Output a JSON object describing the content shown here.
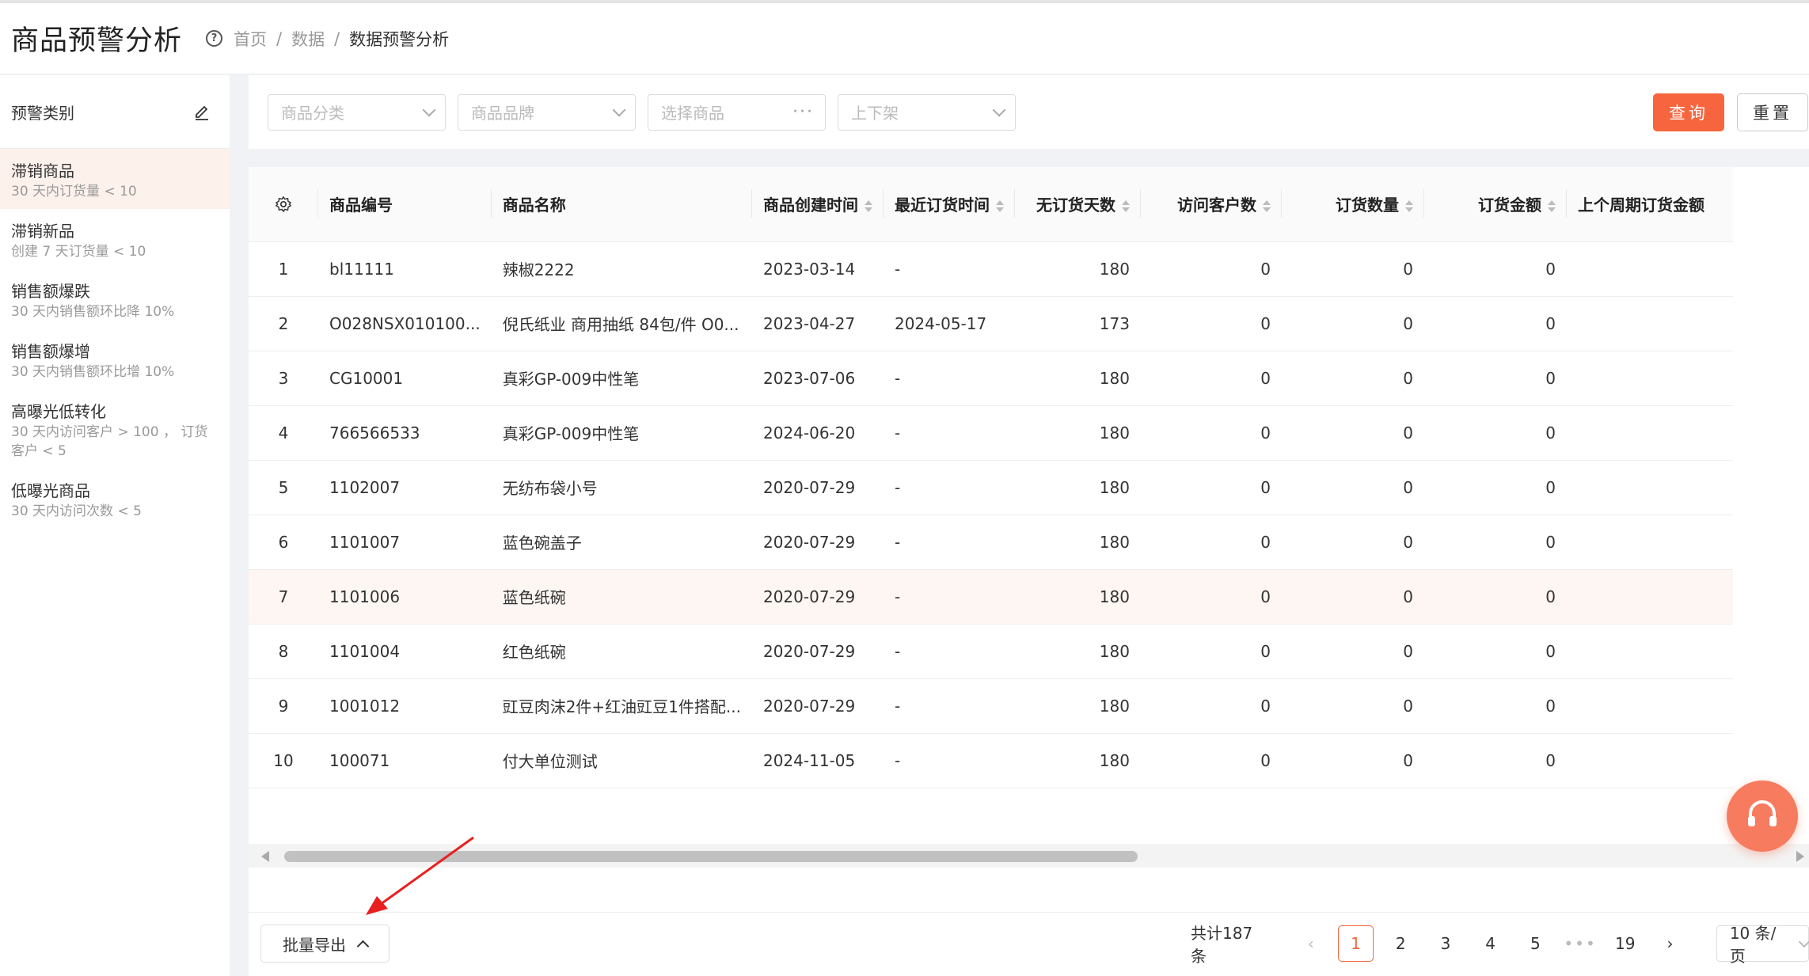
{
  "header": {
    "title": "商品预警分析",
    "breadcrumb": [
      "首页",
      "数据",
      "数据预警分析"
    ]
  },
  "sidebar": {
    "title": "预警类别",
    "items": [
      {
        "name": "滞销商品",
        "desc": "30 天内订货量 < 10"
      },
      {
        "name": "滞销新品",
        "desc": "创建 7 天订货量 < 10"
      },
      {
        "name": "销售额爆跌",
        "desc": "30 天内销售额环比降 10%"
      },
      {
        "name": "销售额爆增",
        "desc": "30 天内销售额环比增 10%"
      },
      {
        "name": "高曝光低转化",
        "desc": "30 天内访问客户 > 100 ， 订货客户 < 5"
      },
      {
        "name": "低曝光商品",
        "desc": "30 天内访问次数 < 5"
      }
    ]
  },
  "filters": {
    "category_placeholder": "商品分类",
    "brand_placeholder": "商品品牌",
    "product_placeholder": "选择商品",
    "status_placeholder": "上下架",
    "query_label": "查询",
    "reset_label": "重置"
  },
  "table": {
    "columns": [
      "商品编号",
      "商品名称",
      "商品创建时间",
      "最近订货时间",
      "无订货天数",
      "访问客户数",
      "订货数量",
      "订货金额",
      "上个周期订货金额"
    ],
    "rows": [
      {
        "idx": "1",
        "code": "bl11111",
        "name": "辣椒2222",
        "created": "2023-03-14",
        "last_order": "-",
        "days": "180",
        "visitors": "0",
        "qty": "0",
        "amount": "0",
        "prev": ""
      },
      {
        "idx": "2",
        "code": "O028NSX010100...",
        "name": "倪氏纸业 商用抽纸 84包/件 O0...",
        "created": "2023-04-27",
        "last_order": "2024-05-17",
        "days": "173",
        "visitors": "0",
        "qty": "0",
        "amount": "0",
        "prev": ""
      },
      {
        "idx": "3",
        "code": "CG10001",
        "name": "真彩GP-009中性笔",
        "created": "2023-07-06",
        "last_order": "-",
        "days": "180",
        "visitors": "0",
        "qty": "0",
        "amount": "0",
        "prev": ""
      },
      {
        "idx": "4",
        "code": "766566533",
        "name": "真彩GP-009中性笔",
        "created": "2024-06-20",
        "last_order": "-",
        "days": "180",
        "visitors": "0",
        "qty": "0",
        "amount": "0",
        "prev": ""
      },
      {
        "idx": "5",
        "code": "1102007",
        "name": "无纺布袋小号",
        "created": "2020-07-29",
        "last_order": "-",
        "days": "180",
        "visitors": "0",
        "qty": "0",
        "amount": "0",
        "prev": ""
      },
      {
        "idx": "6",
        "code": "1101007",
        "name": "蓝色碗盖子",
        "created": "2020-07-29",
        "last_order": "-",
        "days": "180",
        "visitors": "0",
        "qty": "0",
        "amount": "0",
        "prev": ""
      },
      {
        "idx": "7",
        "code": "1101006",
        "name": "蓝色纸碗",
        "created": "2020-07-29",
        "last_order": "-",
        "days": "180",
        "visitors": "0",
        "qty": "0",
        "amount": "0",
        "prev": ""
      },
      {
        "idx": "8",
        "code": "1101004",
        "name": "红色纸碗",
        "created": "2020-07-29",
        "last_order": "-",
        "days": "180",
        "visitors": "0",
        "qty": "0",
        "amount": "0",
        "prev": ""
      },
      {
        "idx": "9",
        "code": "1001012",
        "name": "豇豆肉沫2件+红油豇豆1件搭配...",
        "created": "2020-07-29",
        "last_order": "-",
        "days": "180",
        "visitors": "0",
        "qty": "0",
        "amount": "0",
        "prev": ""
      },
      {
        "idx": "10",
        "code": "100071",
        "name": "付大单位测试",
        "created": "2024-11-05",
        "last_order": "-",
        "days": "180",
        "visitors": "0",
        "qty": "0",
        "amount": "0",
        "prev": ""
      }
    ]
  },
  "footer": {
    "export_label": "批量导出",
    "total_label": "共计187条",
    "pages": [
      "1",
      "2",
      "3",
      "4",
      "5",
      "•••",
      "19"
    ],
    "page_size_label": "10 条/页"
  },
  "colors": {
    "accent": "#f7653f",
    "active_bg": "#fdf1ec",
    "annotation": "#e8201f"
  }
}
